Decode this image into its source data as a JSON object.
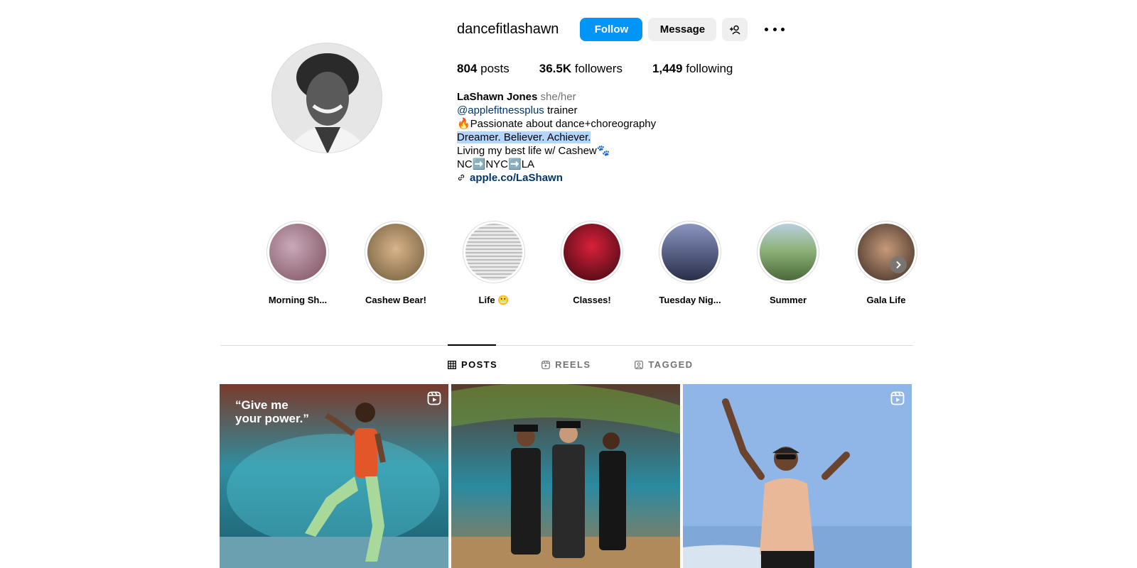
{
  "profile": {
    "username": "dancefitlashawn",
    "follow_label": "Follow",
    "message_label": "Message",
    "stats": {
      "posts_count": "804",
      "posts_label": "posts",
      "followers_count": "36.5K",
      "followers_label": "followers",
      "following_count": "1,449",
      "following_label": "following"
    },
    "bio": {
      "name": "LaShawn Jones",
      "pronouns": "she/her",
      "mention": "@applefitnessplus",
      "mention_suffix": " trainer",
      "line2": "🔥Passionate about dance+choreography",
      "line3": "Dreamer. Believer. Achiever.",
      "line4": "Living my best life w/ Cashew🐾",
      "line5": "NC➡️NYC➡️LA",
      "link": "apple.co/LaShawn"
    }
  },
  "highlights": [
    {
      "label": "Morning Sh...",
      "color_a": "#c9a9b8",
      "color_b": "#7a4e5e"
    },
    {
      "label": "Cashew Bear!",
      "color_a": "#d8b48a",
      "color_b": "#6d5a3a"
    },
    {
      "label": "Life 😬",
      "color_a": "#e4e4e4",
      "color_b": "#bdbdbd"
    },
    {
      "label": "Classes!",
      "color_a": "#d8213a",
      "color_b": "#3a0710"
    },
    {
      "label": "Tuesday Nig...",
      "color_a": "#6f7ca8",
      "color_b": "#2a2f4a"
    },
    {
      "label": "Summer",
      "color_a": "#8fb37a",
      "color_b": "#4a6a3a"
    },
    {
      "label": "Gala Life",
      "color_a": "#c79a7a",
      "color_b": "#3a2a22"
    }
  ],
  "tabs": {
    "posts": "POSTS",
    "reels": "REELS",
    "tagged": "TAGGED"
  },
  "posts": [
    {
      "quote_line1": "“Give me",
      "quote_line2": "your power.”",
      "is_reel": true
    },
    {
      "is_reel": false
    },
    {
      "is_reel": true
    }
  ],
  "colors": {
    "accent": "#0095f6",
    "link": "#00376b",
    "secondary_text": "#737373",
    "selection": "#b4d5fe"
  },
  "icons": {
    "add_user": "add-user-icon",
    "more": "more-icon",
    "link": "link-icon",
    "grid": "grid-icon",
    "reels": "reels-icon",
    "tagged": "tagged-icon",
    "next": "chevron-right-icon"
  }
}
